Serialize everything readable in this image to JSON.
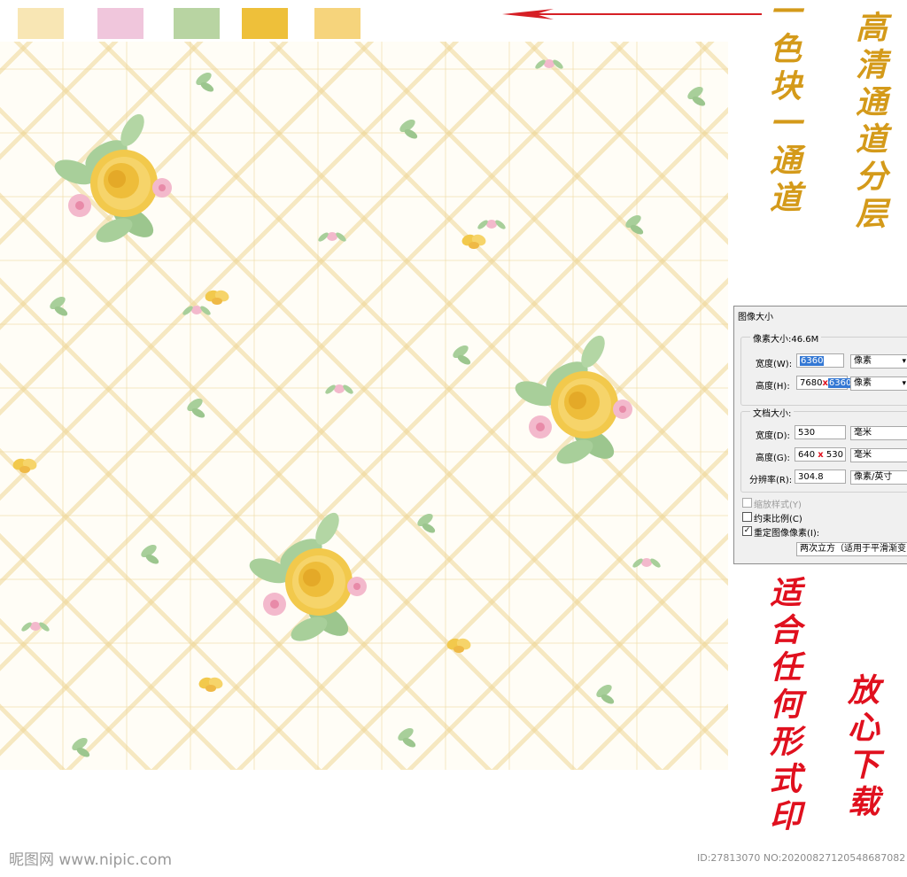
{
  "swatches": [
    {
      "color": "#f8e6b4"
    },
    {
      "color": "#f0c6dc"
    },
    {
      "color": "#b8d4a2"
    },
    {
      "color": "#eec03a"
    },
    {
      "color": "#f6d47c"
    }
  ],
  "arrow_color": "#d61f25",
  "text_one_channel": "一色块一通道",
  "text_hd_channel": "高清通道分层",
  "text_suitable_print": "适合任何形式印",
  "text_download": "放心下载",
  "dialog": {
    "title": "图像大小",
    "pixel_group_label": "像素大小:46.6M",
    "pixel_width_label": "宽度(W):",
    "pixel_width_value": "6360",
    "pixel_width_unit": "像素",
    "pixel_height_label": "高度(H):",
    "pixel_height_old": "7680",
    "pixel_height_value": "6360",
    "pixel_height_unit": "像素",
    "doc_group_label": "文档大小:",
    "doc_width_label": "宽度(D):",
    "doc_width_value": "530",
    "doc_width_unit": "毫米",
    "doc_height_label": "高度(G):",
    "doc_height_old": "640",
    "doc_height_value": "530",
    "doc_height_unit": "毫米",
    "resolution_label": "分辨率(R):",
    "resolution_value": "304.8",
    "resolution_unit": "像素/英寸",
    "scale_styles_label": "缩放样式(Y)",
    "constrain_label": "约束比例(C)",
    "resample_label": "重定图像像素(I):",
    "resample_method": "两次立方（适用于平滑渐变"
  },
  "watermark_site": "昵图网 www.nipic.com",
  "watermark_id": "ID:27813070 NO:20200827120548687082"
}
